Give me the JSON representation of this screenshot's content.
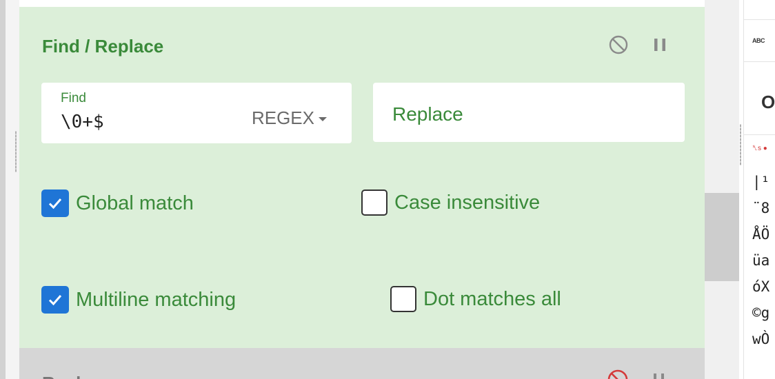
{
  "operation": {
    "title": "Find / Replace",
    "find": {
      "label": "Find",
      "value": "\\0+$",
      "mode": "REGEX"
    },
    "replace": {
      "placeholder": "Replace"
    },
    "options": [
      {
        "label": "Global match",
        "checked": true
      },
      {
        "label": "Case insensitive",
        "checked": false
      },
      {
        "label": "Multiline matching",
        "checked": true
      },
      {
        "label": "Dot matches all",
        "checked": false
      }
    ]
  },
  "next_operation": {
    "title": "Repl…"
  },
  "output": {
    "toolbar_icon": "ABC",
    "title": "O",
    "marker": "␤s ●",
    "lines": [
      "|¹",
      "¨8",
      "ÅÖ",
      "üa",
      "óX",
      "©g",
      "wÒ"
    ]
  },
  "colors": {
    "card_bg": "#dcefd9",
    "accent_green": "#3a8a3a",
    "checkbox_blue": "#1f75d6",
    "next_card_bg": "#d6d6d6"
  },
  "icons": {
    "disable": "ban-icon",
    "pause": "pause-icon",
    "checkmark": "check-icon"
  }
}
